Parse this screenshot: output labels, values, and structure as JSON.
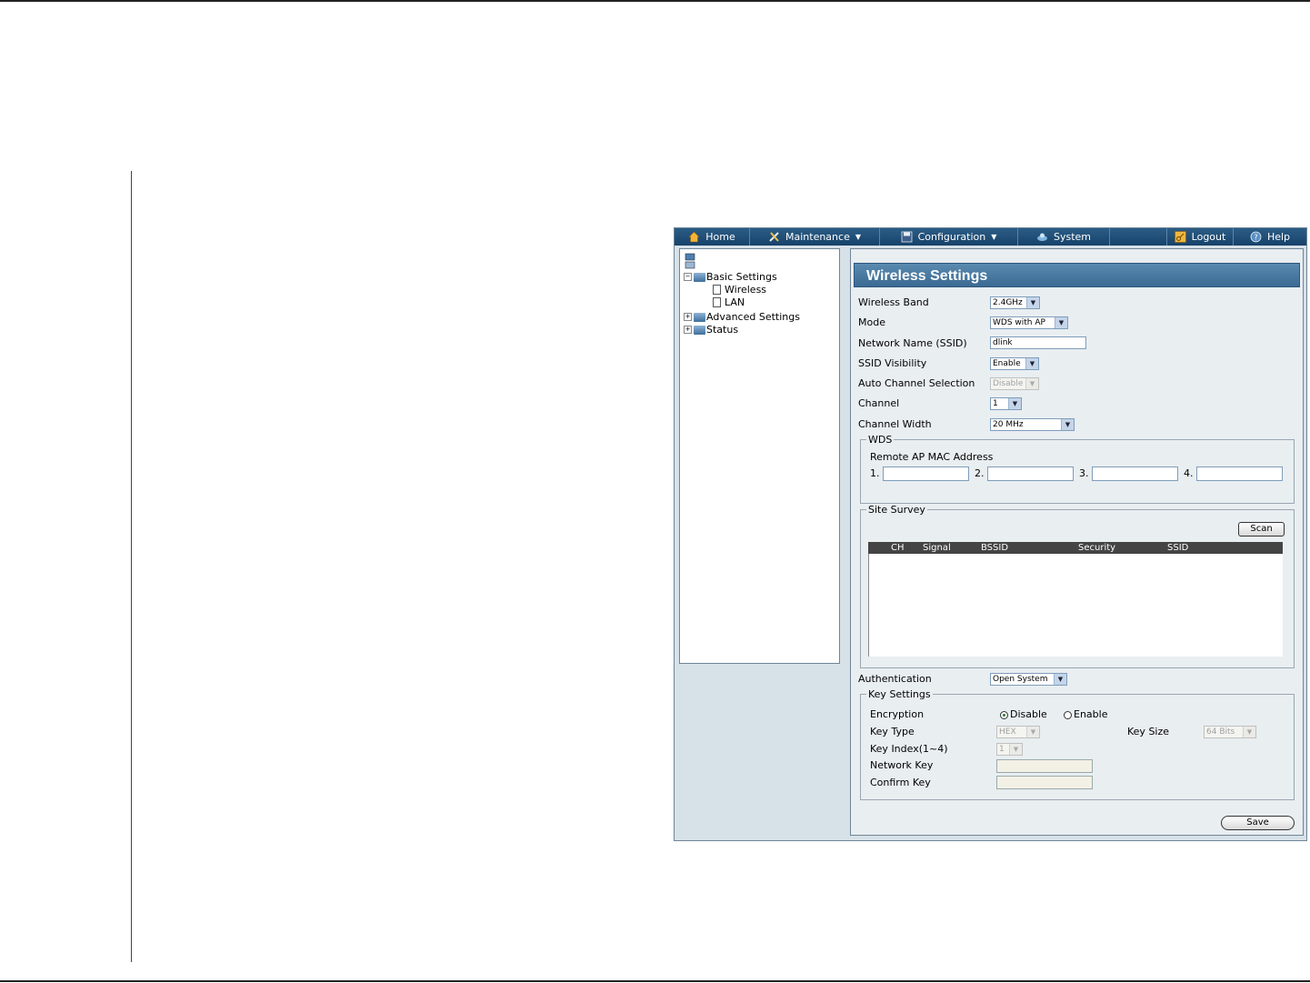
{
  "menu": {
    "home": "Home",
    "maintenance": "Maintenance",
    "configuration": "Configuration",
    "system": "System",
    "logout": "Logout",
    "help": "Help"
  },
  "tree": {
    "basic_settings": "Basic Settings",
    "wireless": "Wireless",
    "lan": "LAN",
    "advanced_settings": "Advanced Settings",
    "status": "Status"
  },
  "page": {
    "title": "Wireless Settings"
  },
  "form": {
    "wireless_band_label": "Wireless Band",
    "wireless_band_value": "2.4GHz",
    "mode_label": "Mode",
    "mode_value": "WDS with AP",
    "ssid_label": "Network Name (SSID)",
    "ssid_value": "dlink",
    "ssid_visibility_label": "SSID Visibility",
    "ssid_visibility_value": "Enable",
    "auto_channel_label": "Auto Channel Selection",
    "auto_channel_value": "Disable",
    "channel_label": "Channel",
    "channel_value": "1",
    "channel_width_label": "Channel Width",
    "channel_width_value": "20 MHz"
  },
  "wds": {
    "legend": "WDS",
    "remote_label": "Remote AP MAC Address",
    "n1": "1.",
    "n2": "2.",
    "n3": "3.",
    "n4": "4."
  },
  "survey": {
    "legend": "Site Survey",
    "scan_label": "Scan",
    "columns": [
      "CH",
      "Signal",
      "BSSID",
      "Security",
      "SSID"
    ]
  },
  "auth": {
    "label": "Authentication",
    "value": "Open System"
  },
  "keys": {
    "legend": "Key Settings",
    "encryption_label": "Encryption",
    "disable_label": "Disable",
    "enable_label": "Enable",
    "key_type_label": "Key Type",
    "key_type_value": "HEX",
    "key_size_label": "Key Size",
    "key_size_value": "64 Bits",
    "key_index_label": "Key Index(1~4)",
    "key_index_value": "1",
    "network_key_label": "Network Key",
    "confirm_key_label": "Confirm Key"
  },
  "save_label": "Save",
  "colors": {
    "menubar": "#1f4e78",
    "title_bar": "#4a7aa2",
    "panel_bg": "#e9eef1"
  }
}
